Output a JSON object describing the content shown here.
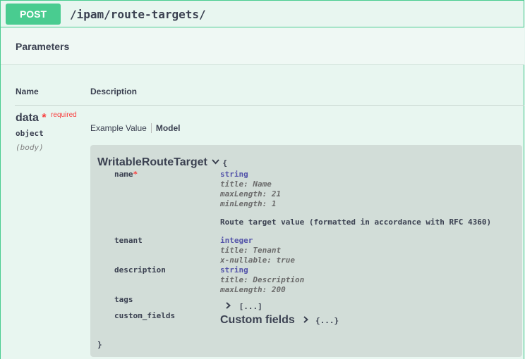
{
  "endpoint": {
    "method": "POST",
    "path": "/ipam/route-targets/"
  },
  "parameters": {
    "title": "Parameters",
    "col_name": "Name",
    "col_description": "Description",
    "param": {
      "name": "data",
      "star": "*",
      "required": "required",
      "type": "object",
      "in": "(body)"
    },
    "tabs": {
      "example": "Example Value",
      "model": "Model"
    }
  },
  "model": {
    "title": "WritableRouteTarget",
    "open_brace": "{",
    "close_brace": "}",
    "props": [
      {
        "name": "name",
        "star": "*",
        "type": "string",
        "title": "title: Name",
        "maxLength": "maxLength: 21",
        "minLength": "minLength: 1",
        "description": "Route target value (formatted in accordance with RFC 4360)"
      },
      {
        "name": "tenant",
        "type": "integer",
        "title": "title: Tenant",
        "nullable": "x-nullable: true"
      },
      {
        "name": "description",
        "type": "string",
        "title": "title: Description",
        "maxLength": "maxLength: 200"
      },
      {
        "name": "tags",
        "collapsed": "[...]"
      },
      {
        "name": "custom_fields",
        "model_title": "Custom fields",
        "collapsed": "{...}"
      }
    ]
  },
  "colors": {
    "post_accent": "#49cc90",
    "required": "#f93e3e",
    "type": "#55a"
  }
}
